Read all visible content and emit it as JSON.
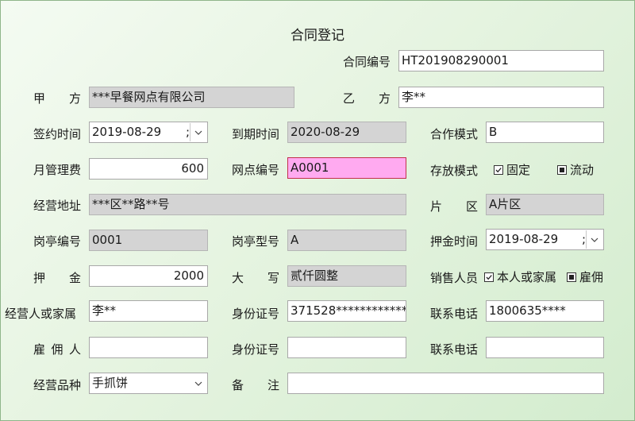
{
  "form": {
    "title": "合同登记",
    "contract_no": {
      "label": "合同编号",
      "value": "HT201908290001"
    },
    "party_a": {
      "label": "甲　　方",
      "value": "***早餐网点有限公司"
    },
    "party_b": {
      "label": "乙　　方",
      "value": "李**"
    },
    "sign_date": {
      "label": "签约时间",
      "value": "2019-08-29",
      "suffix": ";"
    },
    "expire_date": {
      "label": "到期时间",
      "value": "2020-08-29"
    },
    "coop_mode": {
      "label": "合作模式",
      "value": "B"
    },
    "monthly_fee": {
      "label": "月管理费",
      "value": "600"
    },
    "outlet_no": {
      "label": "网点编号",
      "value": "A0001"
    },
    "storage_mode": {
      "label": "存放模式",
      "options": [
        {
          "label": "固定",
          "state": "checked"
        },
        {
          "label": "流动",
          "state": "filled"
        }
      ]
    },
    "address": {
      "label": "经营地址",
      "value": "***区**路**号"
    },
    "district": {
      "label": "片　　区",
      "value": "A片区"
    },
    "kiosk_no": {
      "label": "岗亭编号",
      "value": "0001"
    },
    "kiosk_type": {
      "label": "岗亭型号",
      "value": "A"
    },
    "deposit_date": {
      "label": "押金时间",
      "value": "2019-08-29",
      "suffix": ";"
    },
    "deposit": {
      "label": "押　　金",
      "value": "2000"
    },
    "deposit_caps": {
      "label": "大　　写",
      "value": "贰仟圆整"
    },
    "sales": {
      "label": "销售人员",
      "options": [
        {
          "label": "本人或家属",
          "state": "checked"
        },
        {
          "label": "雇佣",
          "state": "filled"
        }
      ]
    },
    "operator": {
      "label": "经营人或家属",
      "value": "李**"
    },
    "operator_id": {
      "label": "身份证号",
      "value": "371528************"
    },
    "operator_phone": {
      "label": "联系电话",
      "value": "1800635****"
    },
    "employee": {
      "label": "雇 佣 人",
      "value": ""
    },
    "employee_id": {
      "label": "身份证号",
      "value": ""
    },
    "employee_phone": {
      "label": "联系电话",
      "value": ""
    },
    "product": {
      "label": "经营品种",
      "value": "手抓饼"
    },
    "remarks": {
      "label": "备　　注",
      "value": ""
    }
  },
  "icons": {
    "dropdown": "chevron-down-icon",
    "checked_box": "checkbox-checked-icon",
    "filled_box": "checkbox-indeterminate-icon"
  },
  "colors": {
    "background": "#dff0da",
    "readonly": "#d4d4d4",
    "highlight": "#ffaaf0",
    "highlight_border": "#c22f4d"
  }
}
